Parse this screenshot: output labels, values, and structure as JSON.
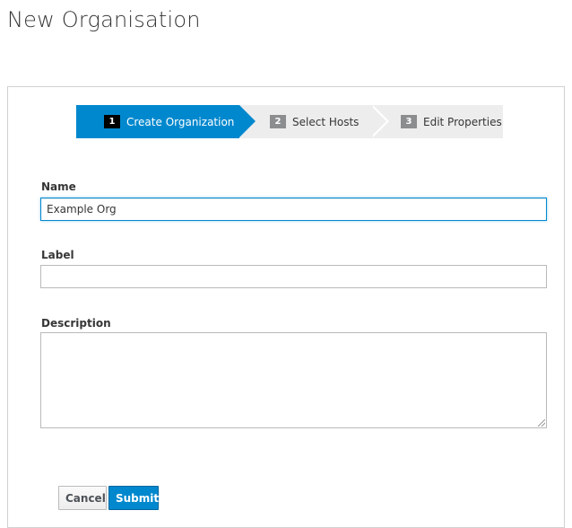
{
  "page": {
    "title": "New Organisation"
  },
  "wizard": {
    "steps": [
      {
        "number": "1",
        "label": "Create Organization",
        "active": true
      },
      {
        "number": "2",
        "label": "Select Hosts",
        "active": false
      },
      {
        "number": "3",
        "label": "Edit Properties",
        "active": false
      }
    ]
  },
  "form": {
    "name": {
      "label": "Name",
      "value": "Example Org"
    },
    "label_field": {
      "label": "Label",
      "value": ""
    },
    "description": {
      "label": "Description",
      "value": ""
    }
  },
  "actions": {
    "cancel_label": "Cancel",
    "submit_label": "Submit"
  },
  "colors": {
    "accent": "#0088ce",
    "step_inactive": "#ededed",
    "step_number_inactive": "#8b8d8f"
  }
}
